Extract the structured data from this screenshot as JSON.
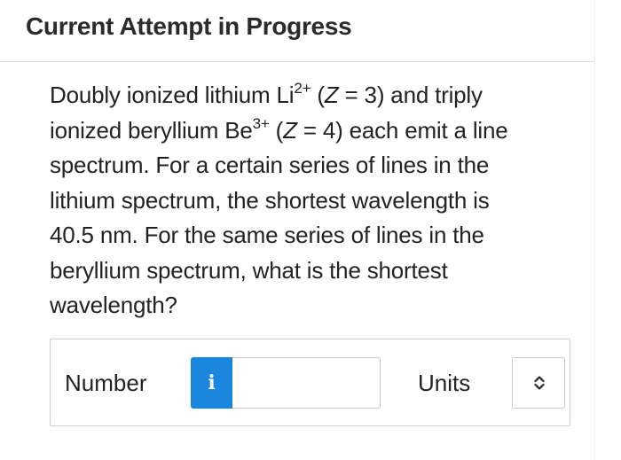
{
  "header": {
    "title": "Current Attempt in Progress"
  },
  "question": {
    "p1": "Doubly ionized lithium Li",
    "li_charge": "2+",
    "p2": " (",
    "z1_var": "Z",
    "z1_val": " = 3) and triply",
    "p3": "ionized beryllium Be",
    "be_charge": "3+",
    "p4": " (",
    "z2_var": "Z",
    "z2_val": " = 4) each emit a line",
    "p5": "spectrum. For a certain series of lines in the",
    "p6": "lithium spectrum, the shortest wavelength is",
    "p7": "40.5 nm. For the same series of lines in the",
    "p8": "beryllium spectrum, what is the shortest",
    "p9": "wavelength?"
  },
  "answer": {
    "number_label": "Number",
    "info_icon_glyph": "i",
    "number_value": "",
    "units_label": "Units",
    "units_selected": ""
  }
}
